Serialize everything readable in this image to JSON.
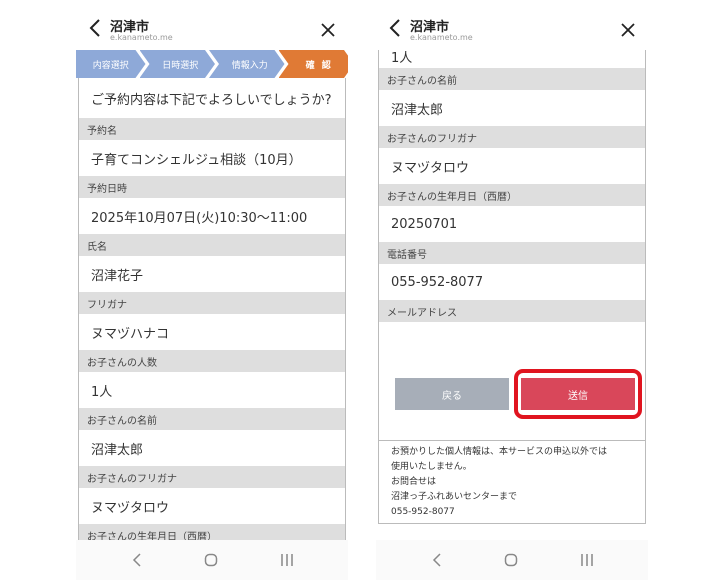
{
  "header": {
    "site_title": "沼津市",
    "site_url": "e.kanameto.me"
  },
  "progress": [
    "内容選択",
    "日時選択",
    "情報入力",
    "確 認"
  ],
  "confirm_question": "ご予約内容は下記でよろしいでしょうか?",
  "labels": {
    "reservation_name": "予約名",
    "reservation_datetime": "予約日時",
    "name": "氏名",
    "furigana": "フリガナ",
    "child_count": "お子さんの人数",
    "child_name": "お子さんの名前",
    "child_furigana": "お子さんのフリガナ",
    "child_birthdate": "お子さんの生年月日（西暦）",
    "phone": "電話番号",
    "email": "メールアドレス"
  },
  "values": {
    "reservation_name": "子育てコンシェルジュ相談（10月）",
    "reservation_datetime": "2025年10月07日(火)10:30〜11:00",
    "name": "沼津花子",
    "furigana": "ヌマヅハナコ",
    "child_count": "1人",
    "child_name": "沼津太郎",
    "child_furigana": "ヌマヅタロウ",
    "child_birthdate": "20250701",
    "phone": "055-952-8077",
    "email": ""
  },
  "buttons": {
    "back": "戻る",
    "send": "送信"
  },
  "notice": {
    "line1": "お預かりした個人情報は、本サービスの申込以外では",
    "line2": "使用いたしません。",
    "line3": "お問合せは",
    "line4": "沼津っ子ふれあいセンターまで",
    "line5": "055-952-8077"
  },
  "colors": {
    "step": "#8ea9d8",
    "step_active": "#e07a35",
    "send": "#d9475a",
    "back": "#a7aeb8",
    "highlight": "#e0141f"
  }
}
